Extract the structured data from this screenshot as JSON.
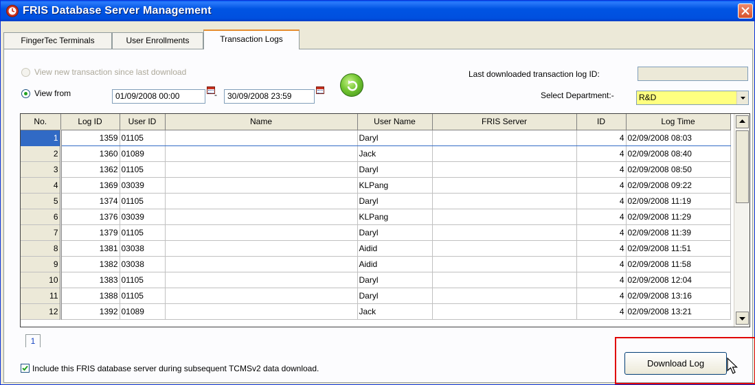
{
  "window": {
    "title": "FRIS Database Server Management"
  },
  "tabs": [
    {
      "label": "FingerTec Terminals"
    },
    {
      "label": "User Enrollments"
    },
    {
      "label": "Transaction Logs"
    }
  ],
  "filters": {
    "view_new_label": "View new transaction since last download",
    "view_from_label": "View from",
    "date_from": "01/09/2008 00:00",
    "date_to": "30/09/2008 23:59",
    "date_separator": "-",
    "last_downloaded_label": "Last downloaded transaction log ID:",
    "last_downloaded_value": "",
    "select_department_label": "Select Department:-",
    "department_value": "R&D"
  },
  "table": {
    "columns": [
      "No.",
      "Log ID",
      "User ID",
      "Name",
      "User Name",
      "FRIS Server",
      "ID",
      "Log Time"
    ],
    "rows": [
      [
        "1",
        "1359",
        "01105",
        "",
        "Daryl",
        "",
        "4",
        "02/09/2008 08:03"
      ],
      [
        "2",
        "1360",
        "01089",
        "",
        "Jack",
        "",
        "4",
        "02/09/2008 08:40"
      ],
      [
        "3",
        "1362",
        "01105",
        "",
        "Daryl",
        "",
        "4",
        "02/09/2008 08:50"
      ],
      [
        "4",
        "1369",
        "03039",
        "",
        "KLPang",
        "",
        "4",
        "02/09/2008 09:22"
      ],
      [
        "5",
        "1374",
        "01105",
        "",
        "Daryl",
        "",
        "4",
        "02/09/2008 11:19"
      ],
      [
        "6",
        "1376",
        "03039",
        "",
        "KLPang",
        "",
        "4",
        "02/09/2008 11:29"
      ],
      [
        "7",
        "1379",
        "01105",
        "",
        "Daryl",
        "",
        "4",
        "02/09/2008 11:39"
      ],
      [
        "8",
        "1381",
        "03038",
        "",
        "Aidid",
        "",
        "4",
        "02/09/2008 11:51"
      ],
      [
        "9",
        "1382",
        "03038",
        "",
        "Aidid",
        "",
        "4",
        "02/09/2008 11:58"
      ],
      [
        "10",
        "1383",
        "01105",
        "",
        "Daryl",
        "",
        "4",
        "02/09/2008 12:04"
      ],
      [
        "11",
        "1388",
        "01105",
        "",
        "Daryl",
        "",
        "4",
        "02/09/2008 13:16"
      ],
      [
        "12",
        "1392",
        "01089",
        "",
        "Jack",
        "",
        "4",
        "02/09/2008 13:21"
      ]
    ]
  },
  "pager": {
    "page": "1"
  },
  "footer": {
    "include_label": "Include this FRIS database server during subsequent TCMSv2 data download.",
    "download_label": "Download Log"
  },
  "colors": {
    "title_bar": "#0054e3",
    "department_bg": "#ffff80",
    "selected_row": "#316ac5",
    "highlight_box": "#e00000"
  },
  "icons": [
    "clock-icon",
    "close-icon",
    "calendar-icon",
    "refresh-icon",
    "check-icon",
    "cursor-icon"
  ]
}
